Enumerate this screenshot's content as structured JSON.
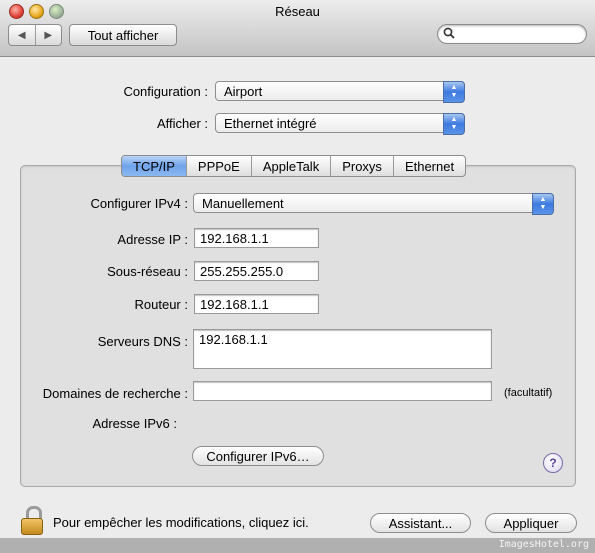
{
  "window": {
    "title": "Réseau",
    "nav_back_glyph": "◀",
    "nav_forward_glyph": "▶",
    "show_all_label": "Tout afficher",
    "search_placeholder": ""
  },
  "top": {
    "configuration_label": "Configuration :",
    "configuration_value": "Airport",
    "show_label": "Afficher :",
    "show_value": "Ethernet intégré"
  },
  "tabs": [
    "TCP/IP",
    "PPPoE",
    "AppleTalk",
    "Proxys",
    "Ethernet"
  ],
  "tcpip": {
    "ipv4_label": "Configurer IPv4 :",
    "ipv4_value": "Manuellement",
    "ip_label": "Adresse IP :",
    "ip_value": "192.168.1.1",
    "subnet_label": "Sous-réseau :",
    "subnet_value": "255.255.255.0",
    "router_label": "Routeur :",
    "router_value": "192.168.1.1",
    "dns_label": "Serveurs DNS :",
    "dns_value": "192.168.1.1",
    "search_domains_label": "Domaines de recherche :",
    "search_domains_value": "",
    "optional_label": "(facultatif)",
    "ipv6_label": "Adresse IPv6 :",
    "ipv6_value": "",
    "configure_ipv6_button": "Configurer IPv6…",
    "help_glyph": "?"
  },
  "footer": {
    "lock_text": "Pour empêcher les modifications, cliquez ici.",
    "assistant_button": "Assistant...",
    "apply_button": "Appliquer"
  },
  "watermark": "ImagesHotel.org",
  "colors": {
    "accent_blue": "#3d7be0",
    "tab_active": "#6fa3ea",
    "lock_gold": "#c38a1d"
  }
}
